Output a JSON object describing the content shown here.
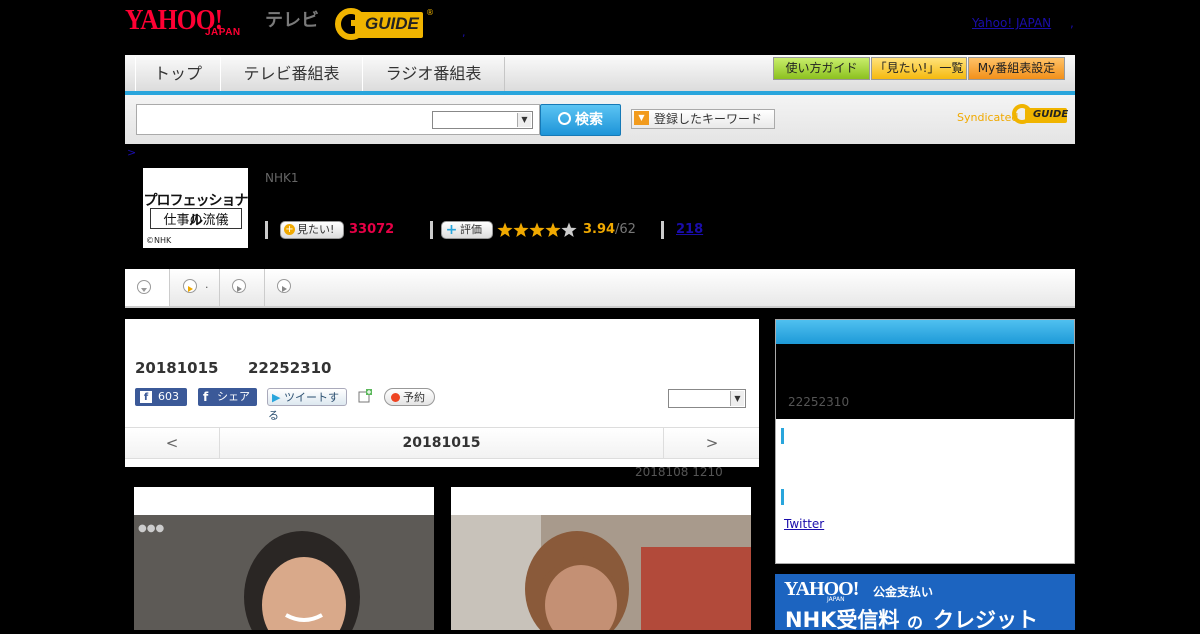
{
  "header": {
    "logo_yahoo": "YAHOO!",
    "logo_japan": "JAPAN",
    "logo_tv": "テレビ",
    "logo_guide": "GUIDE",
    "separator": ",",
    "yahoo_japan_link": "Yahoo! JAPAN",
    "trailing": ","
  },
  "nav": {
    "tabs": [
      "トップ",
      "テレビ番組表",
      "ラジオ番組表"
    ],
    "guide_buttons": [
      "使い方ガイド",
      "「見たい!」一覧",
      "My番組表設定"
    ]
  },
  "search": {
    "value": "",
    "select_value": "",
    "button_label": "検索",
    "keyword_button": "登録したキーワード",
    "syndicated": "Syndicated",
    "syndicated_logo": "GUIDE"
  },
  "program": {
    "breadcrumb": ">",
    "thumb_title_1": "プロフェッショナル",
    "thumb_title_2": "仕事の流儀",
    "thumb_copyright": "©NHK",
    "channel": "NHK1",
    "want_label": "見たい!",
    "want_count": "33072",
    "rate_label": "評価",
    "rating": 3.94,
    "rating_value": "3.94",
    "rating_count": "/62",
    "review_link": "218",
    "star_color": "#f0a900"
  },
  "tabstrip": {
    "second_tab_text": "."
  },
  "main": {
    "date": "20181015",
    "id": "22252310",
    "like_count": "603",
    "share_label": "シェア",
    "tweet_label": "ツイートする",
    "reserve_label": "予約",
    "select_value": "",
    "pager_prev": "<",
    "pager_current": "20181015",
    "pager_next": ">",
    "updated": "2018108  1210"
  },
  "side": {
    "id": "22252310",
    "twitter_link": "Twitter"
  },
  "ad": {
    "brand": "YAHOO!",
    "brand_sub": "JAPAN",
    "title": "公金支払い",
    "headline_1": "NHK受信料",
    "headline_2": "の",
    "headline_3": "クレジット"
  }
}
